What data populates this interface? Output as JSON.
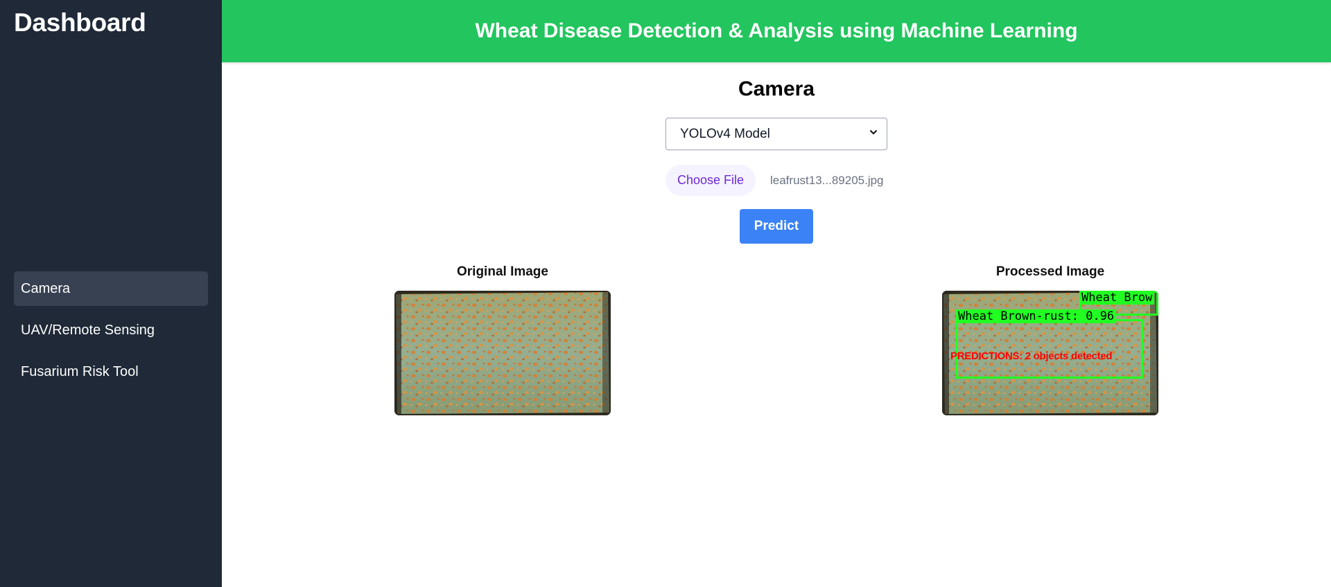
{
  "sidebar": {
    "brand": "Dashboard",
    "items": [
      {
        "label": "Camera",
        "active": true
      },
      {
        "label": "UAV/Remote Sensing",
        "active": false
      },
      {
        "label": "Fusarium Risk Tool",
        "active": false
      }
    ]
  },
  "header": {
    "title": "Wheat Disease Detection & Analysis using Machine Learning",
    "color": "#22c55e"
  },
  "main": {
    "title": "Camera",
    "model_select": {
      "value": "YOLOv4 Model",
      "icon": "chevron-down-icon"
    },
    "file_input": {
      "button_label": "Choose File",
      "file_name": "leafrust13...89205.jpg"
    },
    "predict_label": "Predict",
    "original": {
      "caption": "Original Image"
    },
    "processed": {
      "caption": "Processed Image",
      "detections": [
        {
          "label": "Wheat Brown-rust: 0.96"
        },
        {
          "label": "Wheat Brow"
        }
      ],
      "prediction_text": "PREDICTIONS: 2 objects detected"
    }
  },
  "colors": {
    "sidebar_bg": "#1f2937",
    "sidebar_active": "#374151",
    "accent_green": "#22c55e",
    "predict_blue": "#3b82f6",
    "choose_file_text": "#6d28d9",
    "detection_green": "#22ff22",
    "prediction_red": "#ff0000"
  }
}
